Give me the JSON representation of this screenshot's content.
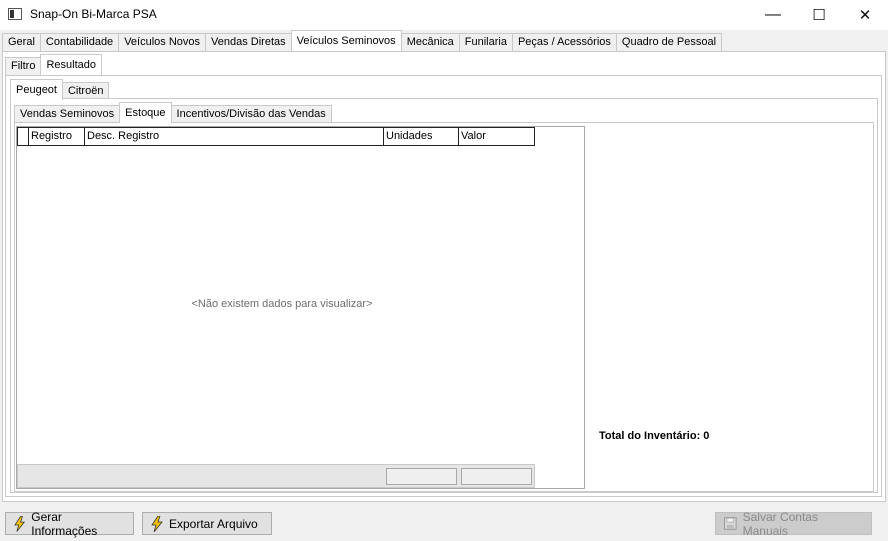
{
  "window": {
    "title": "Snap-On Bi-Marca PSA",
    "minimize_glyph": "—",
    "maximize_glyph": "☐",
    "close_glyph": "✕"
  },
  "main_tabs": [
    {
      "label": "Geral",
      "active": false
    },
    {
      "label": "Contabilidade",
      "active": false
    },
    {
      "label": "Veículos Novos",
      "active": false
    },
    {
      "label": "Vendas Diretas",
      "active": false
    },
    {
      "label": "Veículos Seminovos",
      "active": true
    },
    {
      "label": "Mecânica",
      "active": false
    },
    {
      "label": "Funilaria",
      "active": false
    },
    {
      "label": "Peças / Acessórios",
      "active": false
    },
    {
      "label": "Quadro de Pessoal",
      "active": false
    }
  ],
  "sub_tabs": [
    {
      "label": "Filtro",
      "active": false
    },
    {
      "label": "Resultado",
      "active": true
    }
  ],
  "brand_tabs": [
    {
      "label": "Peugeot",
      "active": true
    },
    {
      "label": "Citroën",
      "active": false
    }
  ],
  "section_tabs": [
    {
      "label": "Vendas Seminovos",
      "active": false
    },
    {
      "label": "Estoque",
      "active": true
    },
    {
      "label": "Incentivos/Divisão das Vendas",
      "active": false
    }
  ],
  "grid": {
    "columns": [
      "Registro",
      "Desc. Registro",
      "Unidades",
      "Valor"
    ],
    "empty_message": "<Não existem dados para visualizar>"
  },
  "summary": {
    "total_label": "Total do Inventário: 0"
  },
  "buttons": {
    "gerar": "Gerar Informações",
    "exportar": "Exportar Arquivo",
    "salvar": "Salvar Contas Manuais"
  },
  "colors": {
    "bolt": "#f2c200",
    "panel_bg": "#ffffff",
    "window_bg": "#f0f0f0"
  }
}
